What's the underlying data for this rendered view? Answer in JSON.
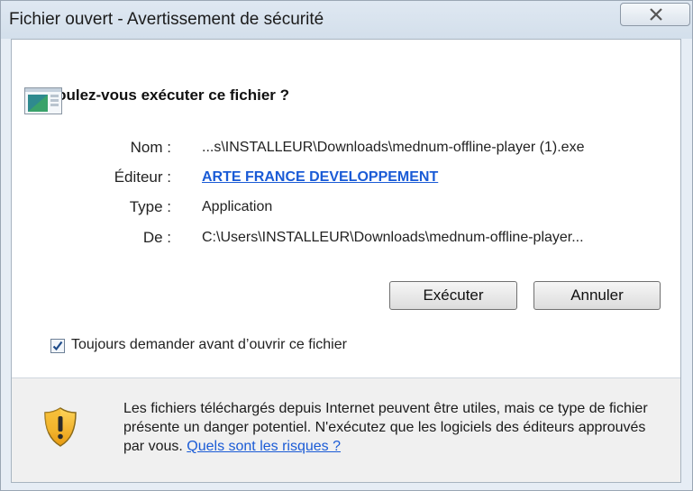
{
  "window": {
    "title": "Fichier ouvert - Avertissement de sécurité",
    "close_icon": "close-icon"
  },
  "dialog": {
    "heading": "Voulez-vous exécuter ce fichier ?",
    "app_icon": "application-icon",
    "fields": {
      "name_label": "Nom :",
      "name_value": "...s\\INSTALLEUR\\Downloads\\mednum-offline-player (1).exe",
      "publisher_label": "Éditeur :",
      "publisher_value": "ARTE FRANCE DEVELOPPEMENT",
      "type_label": "Type :",
      "type_value": "Application",
      "from_label": "De :",
      "from_value": "C:\\Users\\INSTALLEUR\\Downloads\\mednum-offline-player..."
    },
    "buttons": {
      "run": "Exécuter",
      "cancel": "Annuler"
    },
    "checkbox": {
      "label": "Toujours demander avant d’ouvrir ce fichier",
      "checked": true
    },
    "warning": {
      "icon": "shield-warning-icon",
      "text": "Les fichiers téléchargés depuis Internet peuvent être utiles, mais ce type de fichier présente un danger potentiel. N'exécutez que les logiciels des éditeurs approuvés par vous. ",
      "link": "Quels sont les risques ?"
    }
  },
  "colors": {
    "link": "#1a5bd6",
    "frame": "#e6edf5",
    "warning_area": "#f0f0f0"
  }
}
